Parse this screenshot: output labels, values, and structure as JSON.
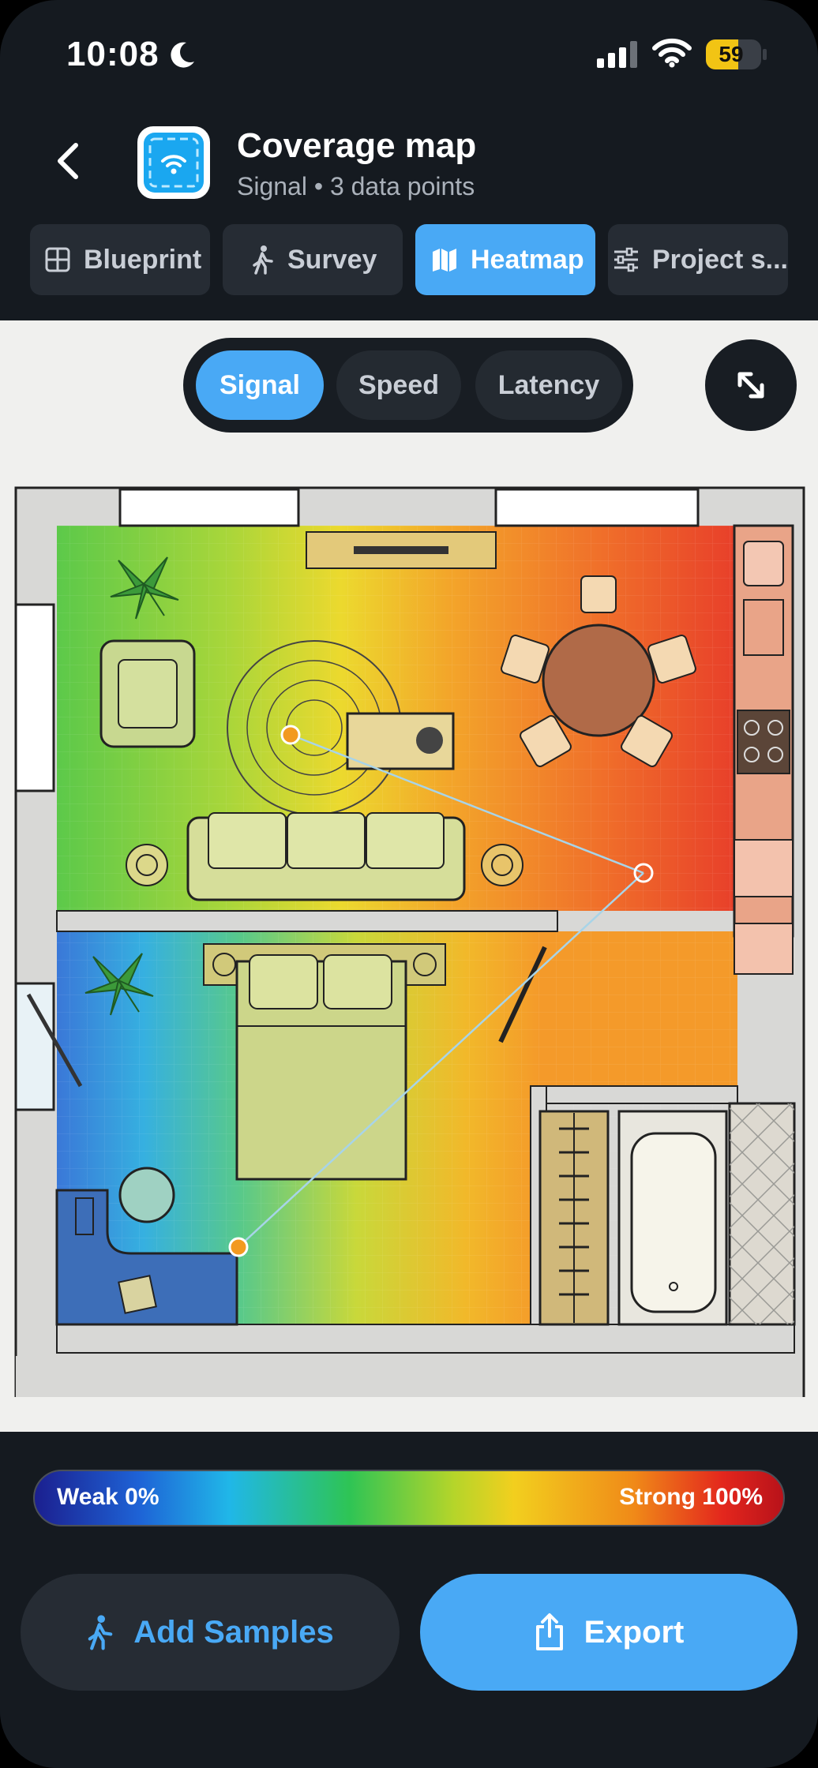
{
  "status_bar": {
    "time": "10:08",
    "battery": "59"
  },
  "header": {
    "title": "Coverage map",
    "subtitle": "Signal • 3 data points"
  },
  "tabs": [
    {
      "label": "Blueprint",
      "icon": "grid-icon"
    },
    {
      "label": "Survey",
      "icon": "walk-icon"
    },
    {
      "label": "Heatmap",
      "icon": "map-icon",
      "active": true
    },
    {
      "label": "Project s...",
      "icon": "sliders-icon"
    }
  ],
  "metric_toggle": {
    "options": [
      "Signal",
      "Speed",
      "Latency"
    ],
    "selected": "Signal"
  },
  "legend": {
    "weak_label": "Weak 0%",
    "strong_label": "Strong 100%"
  },
  "actions": {
    "add_label": "Add Samples",
    "export_label": "Export"
  },
  "colors": {
    "accent": "#49a9f5",
    "background": "#151a20"
  }
}
